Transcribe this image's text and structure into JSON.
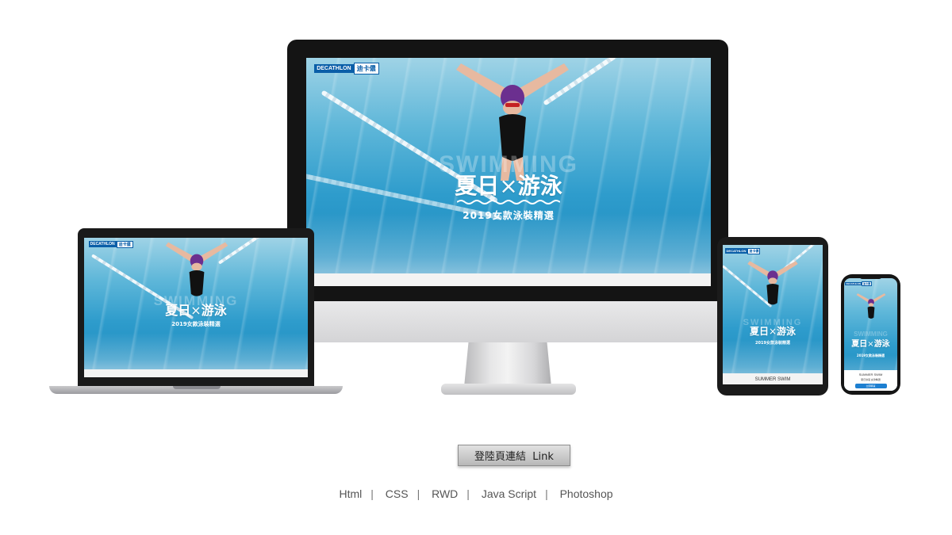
{
  "brand": {
    "logo_text": "DECATHLON",
    "logo_zh": "迪卡儂"
  },
  "hero": {
    "watermark": "SWIMMING",
    "title_left": "夏日",
    "title_right": "游泳",
    "subtitle": "2019女款泳裝精選"
  },
  "mobile": {
    "section_title": "SUMMER SWIM",
    "phone_caption": "夏日泳裝 女款精選",
    "phone_button": "立即購買"
  },
  "link_button": {
    "label": "登陸頁連結  Link"
  },
  "tech_stack": [
    "Html",
    "CSS",
    "RWD",
    "Java Script",
    "Photoshop"
  ],
  "colors": {
    "accent": "#1d7fd1",
    "brand_blue": "#0a5ea8",
    "water": "#2e9ccc"
  }
}
